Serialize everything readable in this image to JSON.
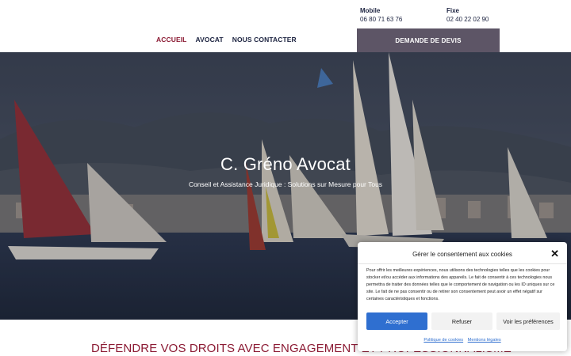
{
  "header": {
    "mobile_label": "Mobile",
    "mobile_number": "06 80 71 63 76",
    "fixe_label": "Fixe",
    "fixe_number": "02 40 22 02 90",
    "nav": [
      "ACCUEIL",
      "AVOCAT",
      "NOUS CONTACTER"
    ],
    "devis_button": "DEMANDE DE DEVIS"
  },
  "hero": {
    "title": "C. Gréno Avocat",
    "subtitle": "Conseil et Assistance Juridique : Solutions sur Mesure pour Tous"
  },
  "section": {
    "title": "DÉFENDRE VOS DROITS AVEC ENGAGEMENT ET PROFESSIONNALISME"
  },
  "cookie": {
    "title": "Gérer le consentement aux cookies",
    "text": "Pour offrir les meilleures expériences, nous utilisons des technologies telles que les cookies pour stocker et/ou accéder aux informations des appareils. Le fait de consentir à ces technologies nous permettra de traiter des données telles que le comportement de navigation ou les ID uniques sur ce site. Le fait de ne pas consentir ou de retirer son consentement peut avoir un effet négatif sur certaines caractéristiques et fonctions.",
    "accept": "Accepter",
    "refuse": "Refuser",
    "prefs": "Voir les préférences",
    "link_cookies": "Politique de cookies",
    "link_legal": "Mentions légales"
  },
  "colors": {
    "accent": "#8b1a33",
    "navy": "#1c2340",
    "devis_bg": "#5d5566",
    "accept_bg": "#2f6fd0"
  }
}
